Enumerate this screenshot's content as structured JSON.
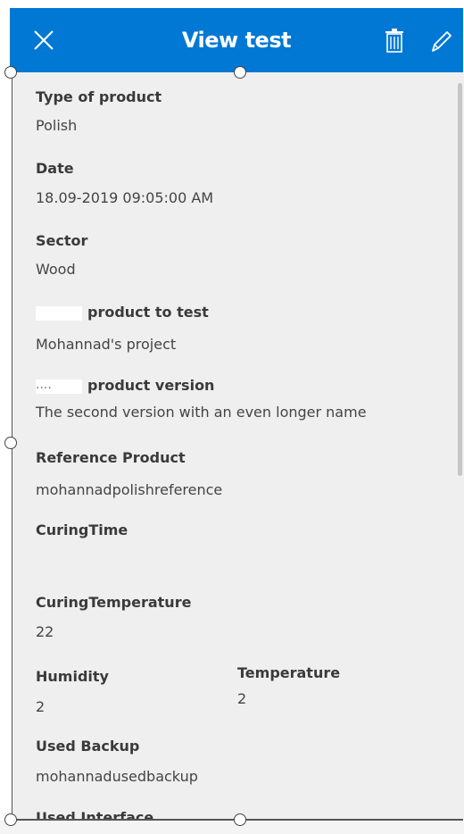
{
  "header": {
    "title": "View test",
    "close_icon": "close-icon",
    "delete_icon": "trash-icon",
    "edit_icon": "pencil-icon",
    "background": "#0078d4"
  },
  "fields": [
    {
      "label": "Type of product",
      "value": "Polish"
    },
    {
      "label": "Date",
      "value": "18.09-2019 09:05:00 AM"
    },
    {
      "label": "Sector",
      "value": "Wood"
    },
    {
      "label": "product to test",
      "value": "Mohannad's project",
      "redacted_prefix": true
    },
    {
      "label": "product version",
      "value": "The second version with an even longer name",
      "redacted_prefix": true,
      "prefix_text": "...."
    },
    {
      "label": "Reference Product",
      "value": "mohannadpolishreference"
    },
    {
      "label": "CuringTime",
      "value": ""
    },
    {
      "label": "CuringTemperature",
      "value": "22"
    },
    {
      "label": "Humidity",
      "value": "2"
    },
    {
      "label": "Temperature",
      "value": "2"
    },
    {
      "label": "Used Backup",
      "value": "mohannadusedbackup"
    },
    {
      "label": "Used Interface",
      "value": ""
    }
  ],
  "colors": {
    "form_background": "#efefef",
    "label": "#3a3a3a",
    "value": "#444444"
  }
}
